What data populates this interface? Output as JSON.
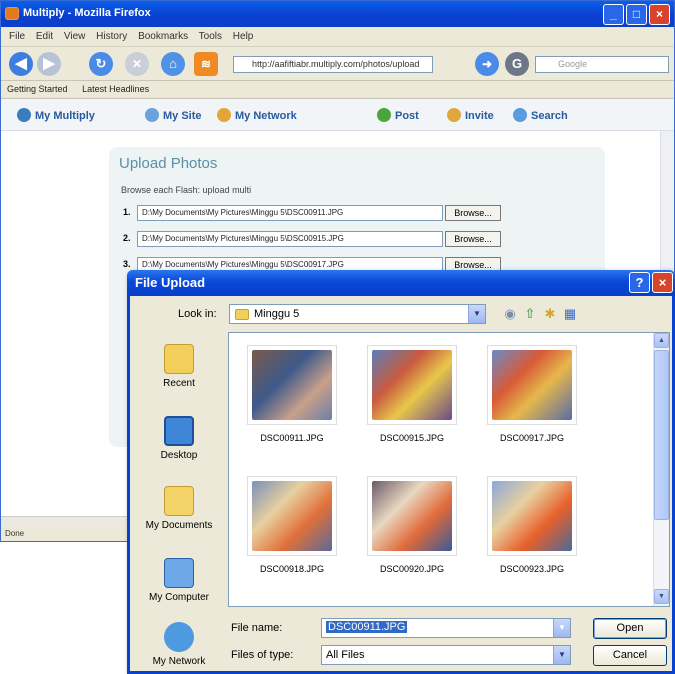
{
  "browser": {
    "title": "Multiply - Mozilla Firefox",
    "menu": "File Edit View History Bookmarks Tools Help",
    "url": "http://aafiftiabr.multiply.com/photos/upload",
    "search_placeholder": "Google",
    "bookmarks": [
      "Getting Started",
      "Latest Headlines"
    ],
    "site_nav": [
      "My Multiply",
      "My Site",
      "My Network",
      "Post",
      "Invite",
      "Search"
    ],
    "status": "Done"
  },
  "upload_page": {
    "heading": "Upload Photos",
    "radios": "Browse each   Flash: upload multi",
    "rows": [
      {
        "num": "1.",
        "path": "D:\\My Documents\\My Pictures\\Minggu 5\\DSC00911.JPG"
      },
      {
        "num": "2.",
        "path": "D:\\My Documents\\My Pictures\\Minggu 5\\DSC00915.JPG"
      },
      {
        "num": "3.",
        "path": "D:\\My Documents\\My Pictures\\Minggu 5\\DSC00917.JPG"
      }
    ],
    "browse_label": "Browse..."
  },
  "dialog": {
    "title": "File Upload",
    "look_in_label": "Look in:",
    "look_in_value": "Minggu 5",
    "places": [
      "Recent",
      "Desktop",
      "My Documents",
      "My Computer",
      "My Network"
    ],
    "files": [
      "DSC00911.JPG",
      "DSC00915.JPG",
      "DSC00917.JPG",
      "DSC00918.JPG",
      "DSC00920.JPG",
      "DSC00923.JPG"
    ],
    "file_name_label": "File name:",
    "file_name_value": "DSC00911.JPG",
    "file_type_label": "Files of type:",
    "file_type_value": "All Files",
    "open_label": "Open",
    "cancel_label": "Cancel"
  }
}
